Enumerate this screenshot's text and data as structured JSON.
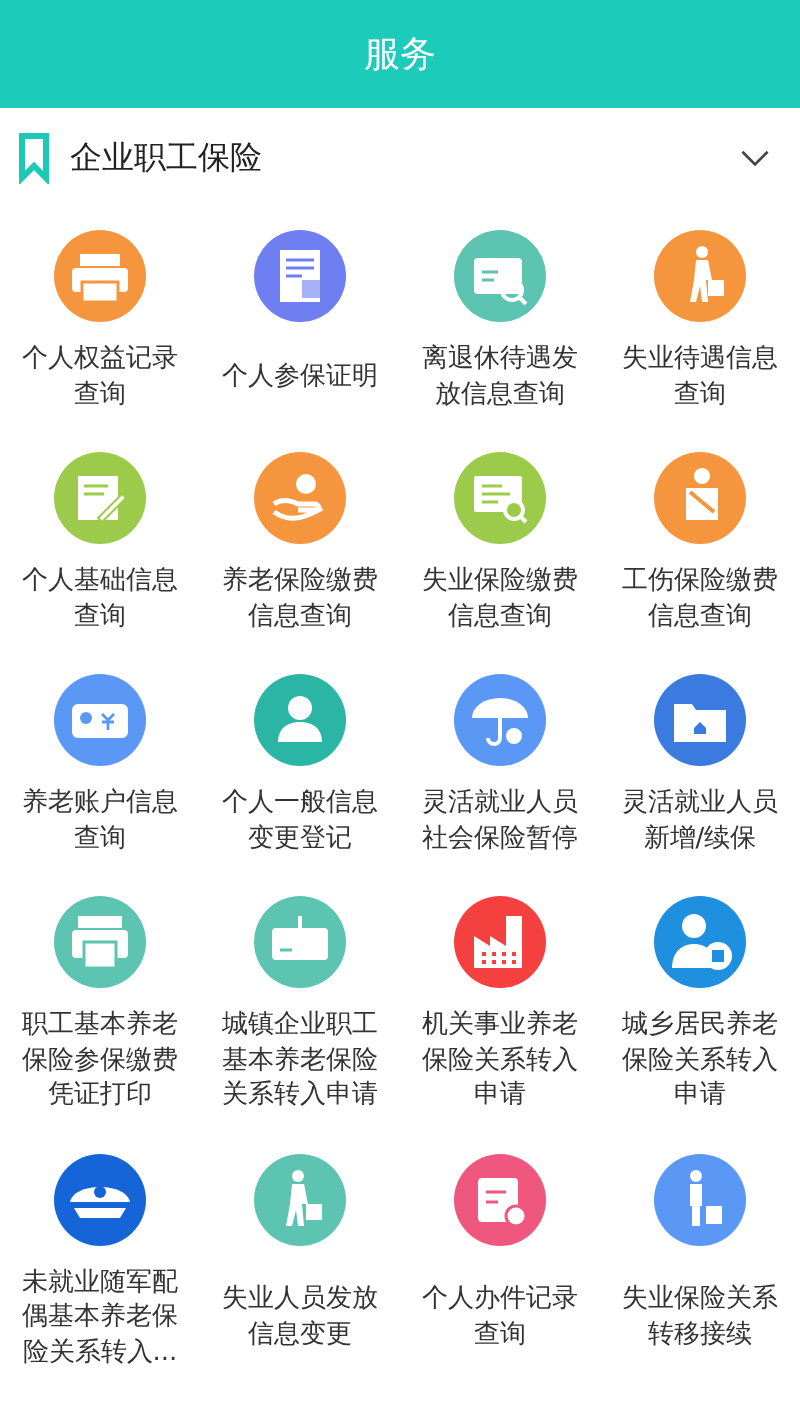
{
  "header": {
    "title": "服务"
  },
  "section": {
    "title": "企业职工保险",
    "expanded": true
  },
  "services": [
    {
      "label": "个人权益记录查询",
      "color": "#f5963f"
    },
    {
      "label": "个人参保证明",
      "color": "#6f7ef0"
    },
    {
      "label": "离退休待遇发放信息查询",
      "color": "#5cc4b0"
    },
    {
      "label": "失业待遇信息查询",
      "color": "#f5963f"
    },
    {
      "label": "个人基础信息查询",
      "color": "#9ccb4c"
    },
    {
      "label": "养老保险缴费信息查询",
      "color": "#f5963f"
    },
    {
      "label": "失业保险缴费信息查询",
      "color": "#9ccb4c"
    },
    {
      "label": "工伤保险缴费信息查询",
      "color": "#f5963f"
    },
    {
      "label": "养老账户信息查询",
      "color": "#5b98f5"
    },
    {
      "label": "个人一般信息变更登记",
      "color": "#2bb5a4"
    },
    {
      "label": "灵活就业人员社会保险暂停",
      "color": "#5b98f5"
    },
    {
      "label": "灵活就业人员新增/续保",
      "color": "#3b7be0"
    },
    {
      "label": "职工基本养老保险参保缴费凭证打印",
      "color": "#5cc4b0"
    },
    {
      "label": "城镇企业职工基本养老保险关系转入申请",
      "color": "#5cc4b0"
    },
    {
      "label": "机关事业养老保险关系转入申请",
      "color": "#f54040"
    },
    {
      "label": "城乡居民养老保险关系转入申请",
      "color": "#1f8fe0"
    },
    {
      "label": "未就业随军配偶基本养老保险关系转入...",
      "color": "#1565d8"
    },
    {
      "label": "失业人员发放信息变更",
      "color": "#5cc4b0"
    },
    {
      "label": "个人办件记录查询",
      "color": "#f0577f"
    },
    {
      "label": "失业保险关系转移接续",
      "color": "#5b98f5"
    }
  ]
}
